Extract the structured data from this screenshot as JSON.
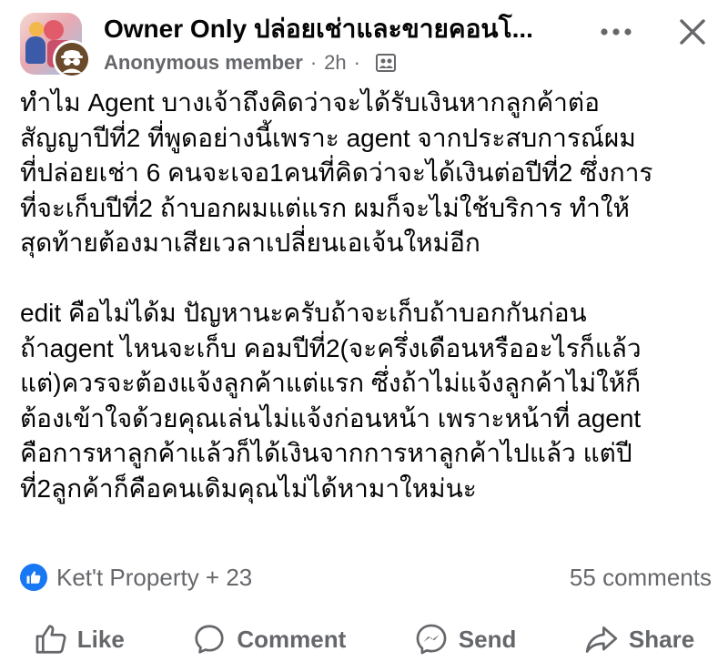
{
  "header": {
    "group_name": "Owner Only ปล่อยเช่าและขายคอนโ...",
    "author": "Anonymous member",
    "separator": "·",
    "time": "2h",
    "separator2": "·",
    "privacy_icon": "group-members-icon"
  },
  "post": {
    "paragraph1": [
      "ทำไม Agent  บางเจ้าถึงคิดว่าจะได้รับเงินหากลูกค้าต่อ",
      "สัญญาปีที่2 ที่พูดอย่างนี้เพราะ agent จากประสบการณ์ผม",
      "ที่ปล่อยเช่า 6 คนจะเจอ1คนที่คิดว่าจะได้เงินต่อปีที่2 ซึ่งการ",
      "ที่จะเก็บปีที่2 ถ้าบอกผมแต่แรก ผมก็จะไม่ใช้บริการ ทำให้",
      "สุดท้ายต้องมาเสียเวลาเปลี่ยนเอเจ้นใหม่อีก"
    ],
    "paragraph2": [
      "edit คือไม่ได้ม ปัญหานะครับถ้าจะเก็บถ้าบอกกันก่อน",
      "ถ้าagent ไหนจะเก็บ คอมปีที่2(จะครึ่งเดือนหรืออะไรก็แล้ว",
      "แต่)ควรจะต้องแจ้งลูกค้าแต่แรก ซึ่งถ้าไม่แจ้งลูกค้าไม่ให้ก็",
      "ต้องเข้าใจด้วยคุณเล่นไม่แจ้งก่อนหน้า เพราะหน้าที่ agent",
      "คือการหาลูกค้าแล้วก็ได้เงินจากการหาลูกค้าไปแล้ว แต่ปี",
      "ที่2ลูกค้าก็คือคนเดิมคุณไม่ได้หามาใหม่นะ"
    ]
  },
  "stats": {
    "reactors": "Ket't Property + 23",
    "comments": "55 comments"
  },
  "actions": {
    "like": "Like",
    "comment": "Comment",
    "send": "Send",
    "share": "Share"
  },
  "colors": {
    "primary_text": "#050505",
    "secondary_text": "#65676b",
    "like_blue": "#1877f2",
    "background": "#ffffff"
  }
}
